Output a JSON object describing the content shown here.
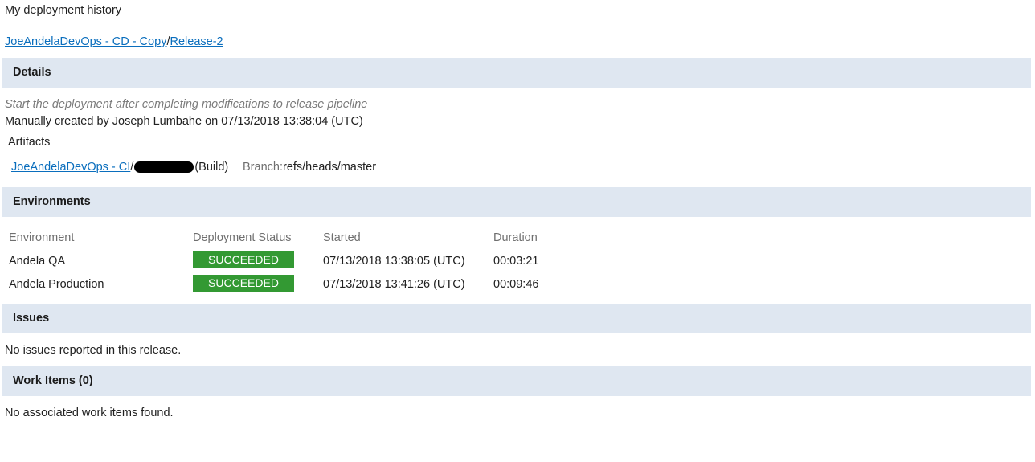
{
  "page": {
    "title": "My deployment history"
  },
  "breadcrumb": {
    "pipeline": "JoeAndelaDevOps - CD - Copy",
    "separator": "/",
    "release": "Release-2"
  },
  "details": {
    "header": "Details",
    "description": "Start the deployment after completing modifications to release pipeline",
    "created_by": "Manually created by Joseph Lumbahe on 07/13/2018 13:38:04 (UTC)",
    "artifacts_label": "Artifacts",
    "artifact": {
      "source": "JoeAndelaDevOps - CI",
      "separator": "/",
      "type_label": "(Build)",
      "branch_label": "Branch:",
      "branch": "refs/heads/master"
    }
  },
  "environments": {
    "header": "Environments",
    "columns": [
      "Environment",
      "Deployment Status",
      "Started",
      "Duration"
    ],
    "rows": [
      {
        "name": "Andela QA",
        "status": "SUCCEEDED",
        "started": "07/13/2018 13:38:05 (UTC)",
        "duration": "00:03:21"
      },
      {
        "name": "Andela Production",
        "status": "SUCCEEDED",
        "started": "07/13/2018 13:41:26 (UTC)",
        "duration": "00:09:46"
      }
    ],
    "status_color": "#339933"
  },
  "issues": {
    "header": "Issues",
    "message": "No issues reported in this release."
  },
  "work_items": {
    "header": "Work Items (0)",
    "message": "No associated work items found."
  },
  "colors": {
    "section_header_bg": "#dfe7f1",
    "link": "#0a6ebd"
  }
}
